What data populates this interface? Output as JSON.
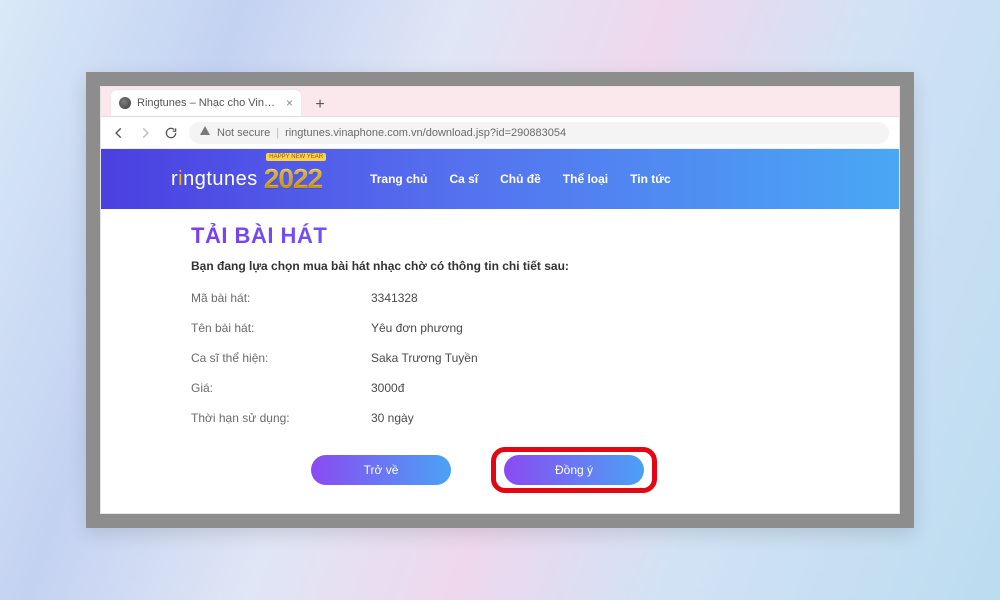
{
  "browser": {
    "tab_title": "Ringtunes – Nhạc cho VinaPhone",
    "security_label": "Not secure",
    "url": "ringtunes.vinaphone.com.vn/download.jsp?id=290883054"
  },
  "header": {
    "logo_text_pre": "r",
    "logo_text_post": "ngtunes",
    "year": "2022",
    "hny": "HAPPY NEW YEAR",
    "nav": [
      "Trang chủ",
      "Ca sĩ",
      "Chủ đề",
      "Thể loại",
      "Tin tức"
    ]
  },
  "page": {
    "title": "TẢI BÀI HÁT",
    "intro": "Bạn đang lựa chọn mua bài hát nhạc chờ có thông tin chi tiết sau:",
    "rows": [
      {
        "label": "Mã bài hát:",
        "value": "3341328"
      },
      {
        "label": "Tên bài hát:",
        "value": "Yêu đơn phương"
      },
      {
        "label": "Ca sĩ thể hiện:",
        "value": "Saka Trương Tuyền"
      },
      {
        "label": "Giá:",
        "value": "3000đ"
      },
      {
        "label": "Thời hạn sử dụng:",
        "value": "30 ngày"
      }
    ],
    "actions": {
      "back": "Trở về",
      "agree": "Đồng ý"
    }
  }
}
